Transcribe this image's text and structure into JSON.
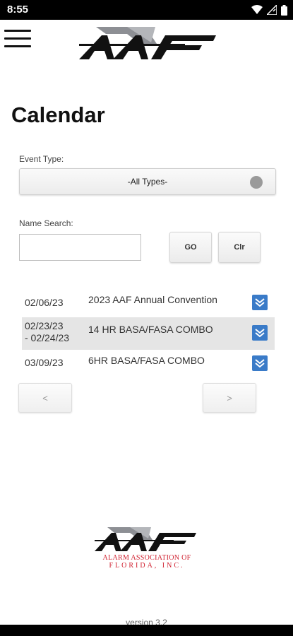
{
  "status_bar": {
    "time": "8:55"
  },
  "page": {
    "title": "Calendar"
  },
  "filters": {
    "event_type_label": "Event Type:",
    "event_type_value": "-All Types-",
    "name_search_label": "Name Search:",
    "name_search_value": "",
    "go_label": "GO",
    "clear_label": "Clr"
  },
  "events": [
    {
      "date_line1": "02/06/23",
      "date_line2": "",
      "name": "2023 AAF Annual Convention"
    },
    {
      "date_line1": "02/23/23",
      "date_line2": "- 02/24/23",
      "name": "14 HR BASA/FASA COMBO"
    },
    {
      "date_line1": "03/09/23",
      "date_line2": "",
      "name": "6HR BASA/FASA COMBO"
    }
  ],
  "pager": {
    "prev_label": "<",
    "next_label": ">"
  },
  "footer": {
    "logo_text": "AAF",
    "org_line1": "ALARM ASSOCIATION OF",
    "org_line2": "FLORIDA, INC.",
    "version": "version 3.2"
  },
  "colors": {
    "accent_blue": "#3a7bc8",
    "brand_red": "#d0202f"
  },
  "icons": [
    "hamburger-menu-icon",
    "wifi-icon",
    "signal-icon",
    "battery-icon",
    "chevron-down-icon"
  ]
}
